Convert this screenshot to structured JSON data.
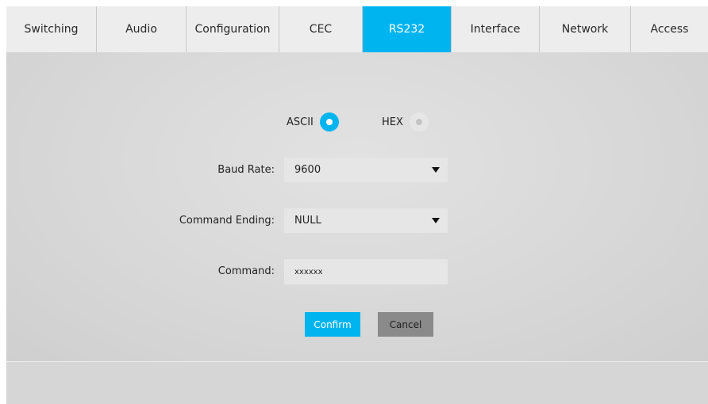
{
  "tabs": [
    {
      "label": "Switching"
    },
    {
      "label": "Audio"
    },
    {
      "label": "Configuration"
    },
    {
      "label": "CEC"
    },
    {
      "label": "RS232",
      "active": true
    },
    {
      "label": "Interface"
    },
    {
      "label": "Network"
    },
    {
      "label": "Access"
    }
  ],
  "mode": {
    "ascii_label": "ASCII",
    "hex_label": "HEX",
    "selected": "ASCII"
  },
  "baud_rate": {
    "label": "Baud Rate:",
    "value": "9600"
  },
  "command_ending": {
    "label": "Command Ending:",
    "value": "NULL"
  },
  "command": {
    "label": "Command:",
    "value": "xxxxxx"
  },
  "buttons": {
    "confirm": "Confirm",
    "cancel": "Cancel"
  },
  "colors": {
    "accent": "#00b4f0",
    "cancel": "#8a8a8a",
    "background": "#d6d6d6",
    "tabbar": "#ededed"
  }
}
